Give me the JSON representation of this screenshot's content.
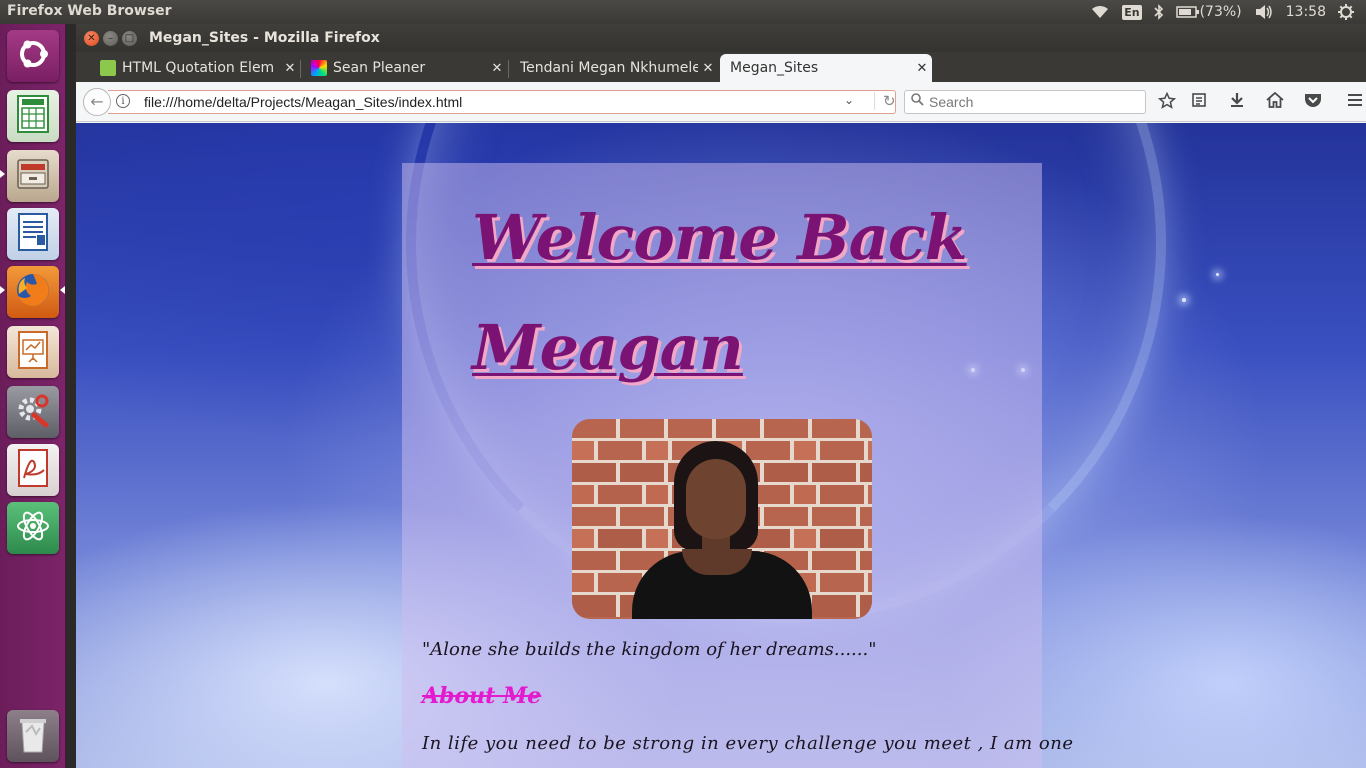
{
  "system": {
    "app_title": "Firefox Web Browser",
    "keyboard_layout": "En",
    "battery": "(73%)",
    "clock": "13:58"
  },
  "launcher": {
    "items": [
      {
        "name": "ubuntu-dash",
        "icon": "ubuntu-logo-icon",
        "color": "#8a2a6e"
      },
      {
        "name": "libreoffice-calc",
        "icon": "spreadsheet-icon",
        "color": "#2f8d3a"
      },
      {
        "name": "files",
        "icon": "file-cabinet-icon",
        "color": "#8b7a66"
      },
      {
        "name": "libreoffice-writer",
        "icon": "document-icon",
        "color": "#2a5aa0"
      },
      {
        "name": "firefox",
        "icon": "firefox-icon",
        "color": "#e8741c"
      },
      {
        "name": "libreoffice-impress",
        "icon": "presentation-icon",
        "color": "#c86a2a"
      },
      {
        "name": "system-settings",
        "icon": "settings-wrench-icon",
        "color": "#6a6a70"
      },
      {
        "name": "document-viewer",
        "icon": "pdf-viewer-icon",
        "color": "#c0392b"
      },
      {
        "name": "atom",
        "icon": "atom-icon",
        "color": "#3b9a5a"
      },
      {
        "name": "trash",
        "icon": "trash-icon",
        "color": "#7a6f78"
      }
    ]
  },
  "window": {
    "title": "Megan_Sites - Mozilla Firefox"
  },
  "tabs": [
    {
      "label": "HTML Quotation Elem",
      "favicon_color": "#8cc84b"
    },
    {
      "label": "Sean Pleaner",
      "favicon_color": "#ff00aa"
    },
    {
      "label": "Tendani Megan Nkhumele",
      "favicon_color": ""
    },
    {
      "label": "Megan_Sites",
      "favicon_color": ""
    }
  ],
  "navbar": {
    "url": "file:///home/delta/Projects/Meagan_Sites/index.html",
    "search_placeholder": "Search"
  },
  "page": {
    "heading": "Welcome Back Meagan",
    "quote": "\"Alone she builds the kingdom of her dreams......\"",
    "about_heading": "About Me",
    "about_text": "In life you need to be strong in every challenge you meet , I am one"
  },
  "colors": {
    "heading": "#7a1373",
    "heading_shadow": "#f2a7c7",
    "about_heading": "#e31ad0",
    "launcher": "#7c2469"
  }
}
